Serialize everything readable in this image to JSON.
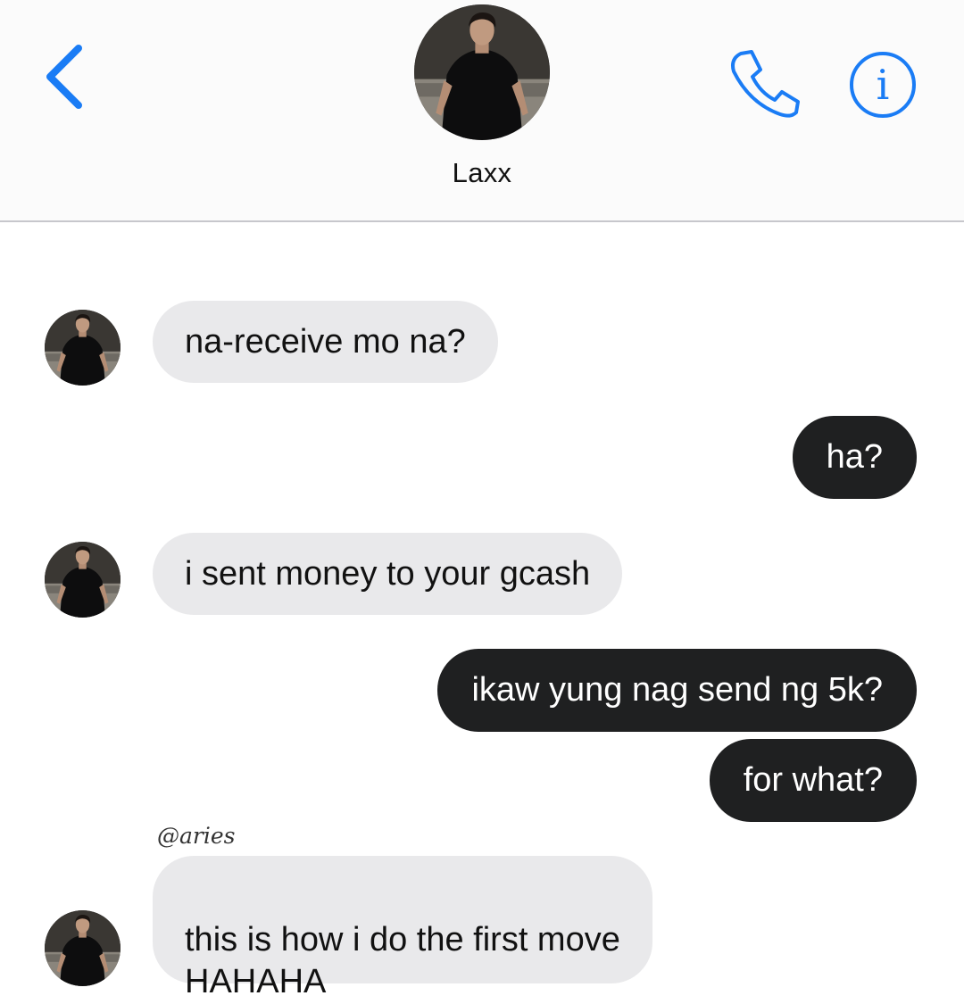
{
  "header": {
    "contact_name": "Laxx",
    "back_icon": "chevron-left-icon",
    "call_icon": "phone-icon",
    "info_icon": "info-icon",
    "info_glyph": "i",
    "accent_color": "#1a7cf5"
  },
  "messages": [
    {
      "sender": "contact",
      "text": "na-receive mo na?"
    },
    {
      "sender": "me",
      "text": "ha?"
    },
    {
      "sender": "contact",
      "text": "i sent money to your gcash"
    },
    {
      "sender": "me",
      "text": "ikaw yung nag send ng 5k?"
    },
    {
      "sender": "me",
      "text": "for what?"
    },
    {
      "sender": "contact",
      "text": "this is how i do the first move\nHAHAHA"
    }
  ],
  "watermark": "@aries",
  "colors": {
    "incoming_bubble": "#e9e9eb",
    "outgoing_bubble": "#1f2021"
  }
}
